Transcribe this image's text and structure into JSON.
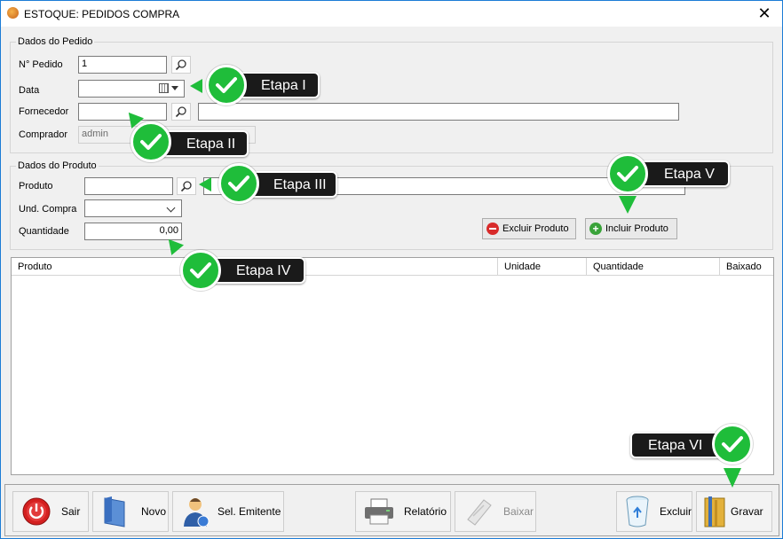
{
  "window": {
    "title": "ESTOQUE: PEDIDOS COMPRA",
    "close_glyph": "✕"
  },
  "pedido": {
    "legend": "Dados do Pedido",
    "numero_label": "N° Pedido",
    "numero_value": "1",
    "data_label": "Data",
    "data_value": "",
    "fornecedor_label": "Fornecedor",
    "fornecedor_value": "",
    "fornecedor_nome": "",
    "comprador_label": "Comprador",
    "comprador_value": "admin"
  },
  "produto": {
    "legend": "Dados do Produto",
    "produto_label": "Produto",
    "produto_value": "",
    "produto_nome": "",
    "und_label": "Und. Compra",
    "und_value": "",
    "qtd_label": "Quantidade",
    "qtd_value": "0,00",
    "excluir_label": "Excluir Produto",
    "incluir_label": "Incluir Produto"
  },
  "grid": {
    "columns": [
      "Produto",
      "Unidade",
      "Quantidade",
      "Baixado"
    ],
    "rows": []
  },
  "toolbar": {
    "sair": "Sair",
    "novo": "Novo",
    "sel_emitente": "Sel. Emitente",
    "relatorio": "Relatório",
    "baixar": "Baixar",
    "excluir": "Excluir",
    "gravar": "Gravar"
  },
  "callouts": {
    "etapa1": "Etapa I",
    "etapa2": "Etapa II",
    "etapa3": "Etapa III",
    "etapa4": "Etapa IV",
    "etapa5": "Etapa V",
    "etapa6": "Etapa VI"
  },
  "colors": {
    "check_green": "#1fbd3a",
    "callout_bg": "#1a1a1a",
    "window_border": "#1c7cd6"
  }
}
